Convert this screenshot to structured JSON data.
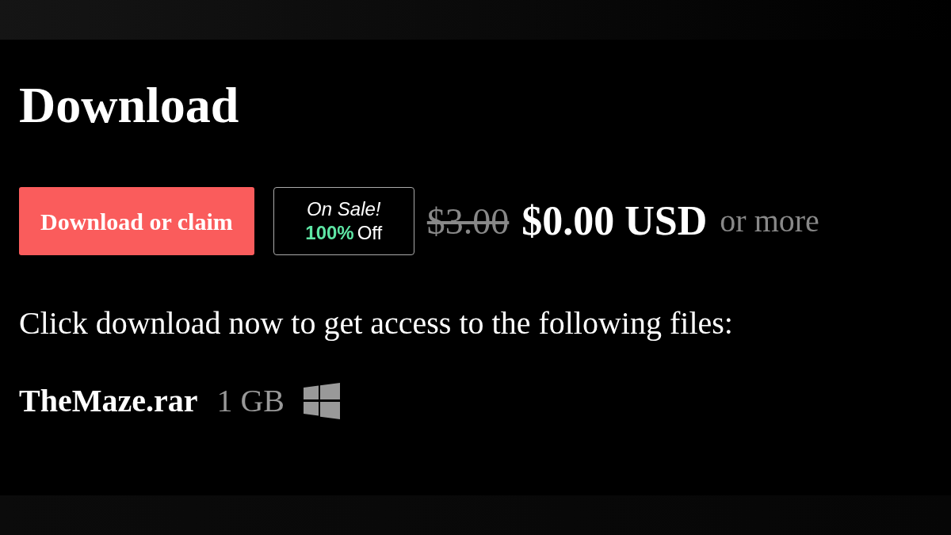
{
  "title": "Download",
  "buy": {
    "button": "Download or claim",
    "sale": {
      "label": "On Sale!",
      "discount": "100%",
      "suffix": "Off"
    },
    "original_price": "$3.00",
    "price": "$0.00 USD",
    "note": "or more"
  },
  "instructions": "Click download now to get access to the following files:",
  "files": [
    {
      "name": "TheMaze.rar",
      "size": "1 GB",
      "kind": "windows"
    }
  ]
}
